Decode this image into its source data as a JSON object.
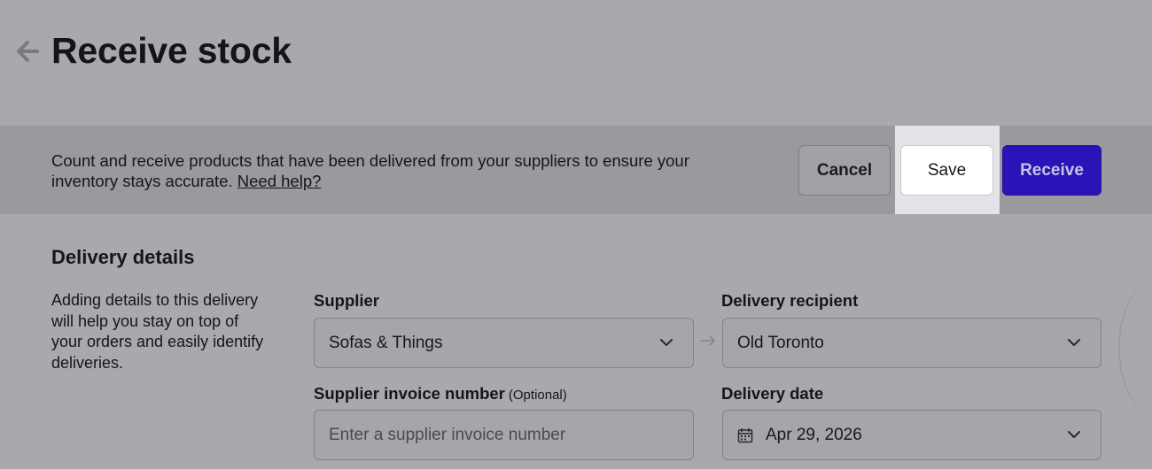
{
  "header": {
    "title": "Receive stock",
    "back_icon": "arrow-left-icon"
  },
  "banner": {
    "text": "Count and receive products that have been delivered from your suppliers to ensure your inventory stays accurate.",
    "help_link": "Need help?",
    "cancel_label": "Cancel",
    "save_label": "Save",
    "receive_label": "Receive"
  },
  "delivery": {
    "title": "Delivery details",
    "description": "Adding details to this delivery will help you stay on top of your orders and easily identify deliveries.",
    "supplier": {
      "label": "Supplier",
      "value": "Sofas & Things"
    },
    "recipient": {
      "label": "Delivery recipient",
      "value": "Old Toronto"
    },
    "invoice": {
      "label": "Supplier invoice number",
      "optional": "(Optional)",
      "placeholder": "Enter a supplier invoice number"
    },
    "date": {
      "label": "Delivery date",
      "value": "Apr 29, 2026"
    }
  },
  "colors": {
    "primary": "#2a14b8",
    "overlay_bg": "#a9a8ad",
    "banner_bg": "#9a999e"
  }
}
